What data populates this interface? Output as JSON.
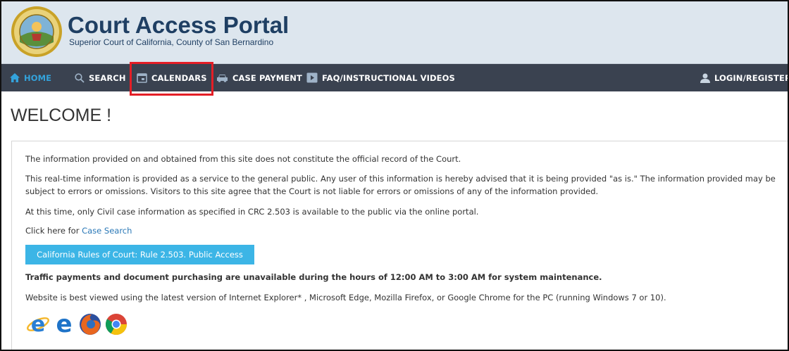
{
  "header": {
    "title": "Court Access Portal",
    "subtitle": "Superior Court of California, County of San Bernardino"
  },
  "nav": {
    "items": [
      {
        "label": "HOME",
        "icon": "home-icon"
      },
      {
        "label": "SEARCH",
        "icon": "search-icon"
      },
      {
        "label": "CALENDARS",
        "icon": "calendar-icon"
      },
      {
        "label": "CASE PAYMENT",
        "icon": "car-icon"
      },
      {
        "label": "FAQ/INSTRUCTIONAL VIDEOS",
        "icon": "video-icon"
      },
      {
        "label": "LOGIN/REGISTER",
        "icon": "user-icon"
      }
    ]
  },
  "main": {
    "heading": "WELCOME !",
    "para1": "The information provided on and obtained from this site does not constitute the official record of the Court.",
    "para2": "This real-time information is provided as a service to the general public. Any user of this information is hereby advised that it is being provided \"as is.\" The information provided may be subject to errors or omissions. Visitors to this site agree that the Court is not liable for errors or omissions of any of the information provided.",
    "para3": "At this time, only Civil case information as specified in CRC 2.503 is available to the public via the online portal.",
    "click_prefix": "Click here for ",
    "case_search_link": "Case Search",
    "rule_button": "California Rules of Court: Rule 2.503. Public Access",
    "maintenance": "Traffic payments and document purchasing are unavailable during the hours of 12:00 AM to 3:00 AM for system maintenance.",
    "browser_note": "Website is best viewed using the latest version of Internet Explorer* , Microsoft Edge, Mozilla Firefox, or Google Chrome for the PC (running Windows 7 or 10)."
  },
  "colors": {
    "nav_bg": "#3a4250",
    "active": "#33a3dc",
    "header_bg": "#dde6ee",
    "title": "#1f3f63",
    "button": "#3cb5e6",
    "highlight": "#e41e26"
  },
  "browser_icons": [
    "internet-explorer-icon",
    "edge-icon",
    "firefox-icon",
    "chrome-icon"
  ]
}
